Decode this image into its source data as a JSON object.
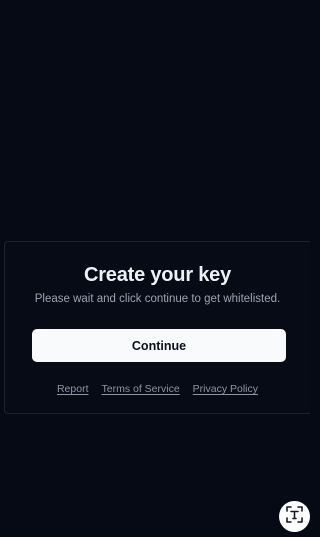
{
  "card": {
    "title": "Create your key",
    "subtitle": "Please wait and click continue to get whitelisted.",
    "continue_label": "Continue"
  },
  "footer_links": {
    "report": "Report",
    "terms": "Terms of Service",
    "privacy": "Privacy Policy"
  },
  "fab": {
    "icon": "text-scan-icon"
  },
  "colors": {
    "background": "#050a14",
    "button_bg": "#f8fafc",
    "title": "#eef2f8",
    "muted": "#9aa3b3"
  }
}
